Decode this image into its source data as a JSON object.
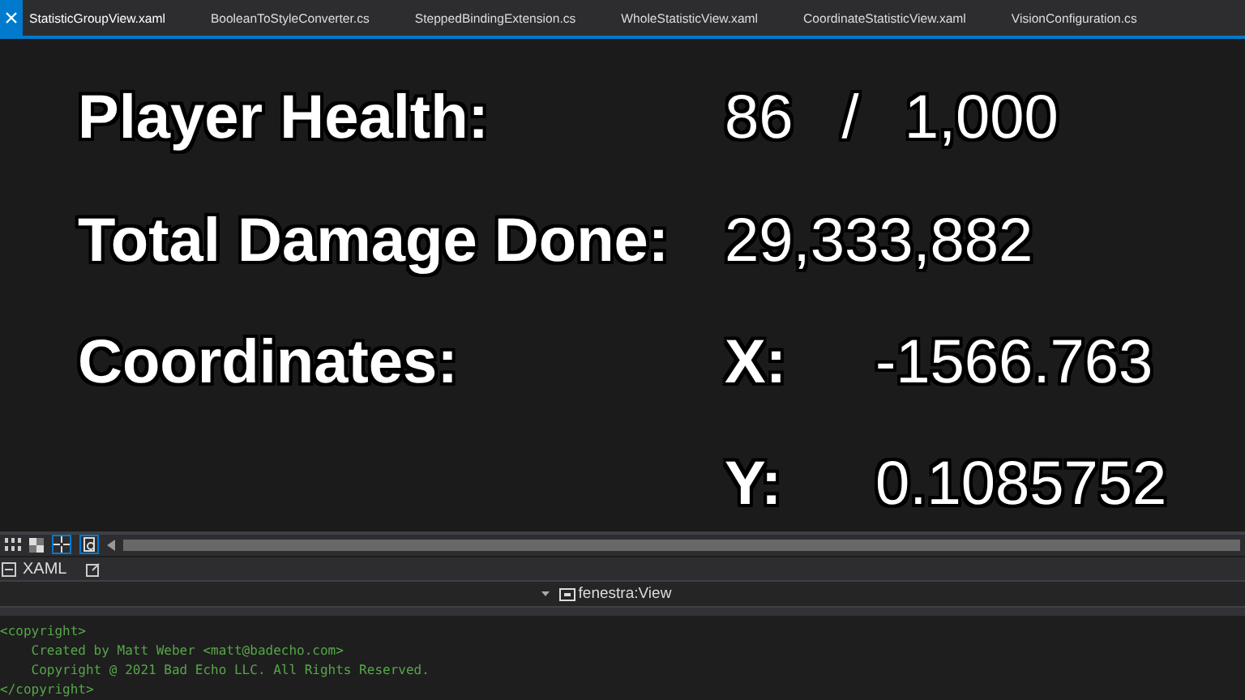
{
  "tabs": [
    {
      "label": "StatisticGroupView.xaml",
      "selected": true
    },
    {
      "label": "BooleanToStyleConverter.cs",
      "selected": false
    },
    {
      "label": "SteppedBindingExtension.cs",
      "selected": false
    },
    {
      "label": "WholeStatisticView.xaml",
      "selected": false
    },
    {
      "label": "CoordinateStatisticView.xaml",
      "selected": false
    },
    {
      "label": "VisionConfiguration.cs",
      "selected": false
    }
  ],
  "stats": [
    {
      "kind": "ratio",
      "label": "Player Health:",
      "value": "86",
      "separator": "/",
      "total": "1,000"
    },
    {
      "kind": "number",
      "label": "Total Damage Done:",
      "value": "29,333,882"
    },
    {
      "kind": "axis",
      "label": "Coordinates:",
      "axis": "X:",
      "value": "-1566.763"
    },
    {
      "kind": "axis",
      "axis": "Y:",
      "value": "0.1085752"
    }
  ],
  "pane": {
    "title": "XAML",
    "breadcrumb": "fenestra:View"
  },
  "code": [
    "<copyright>",
    "    Created by Matt Weber <matt@badecho.com>",
    "    Copyright @ 2021 Bad Echo LLC. All Rights Reserved.",
    "</copyright>"
  ]
}
